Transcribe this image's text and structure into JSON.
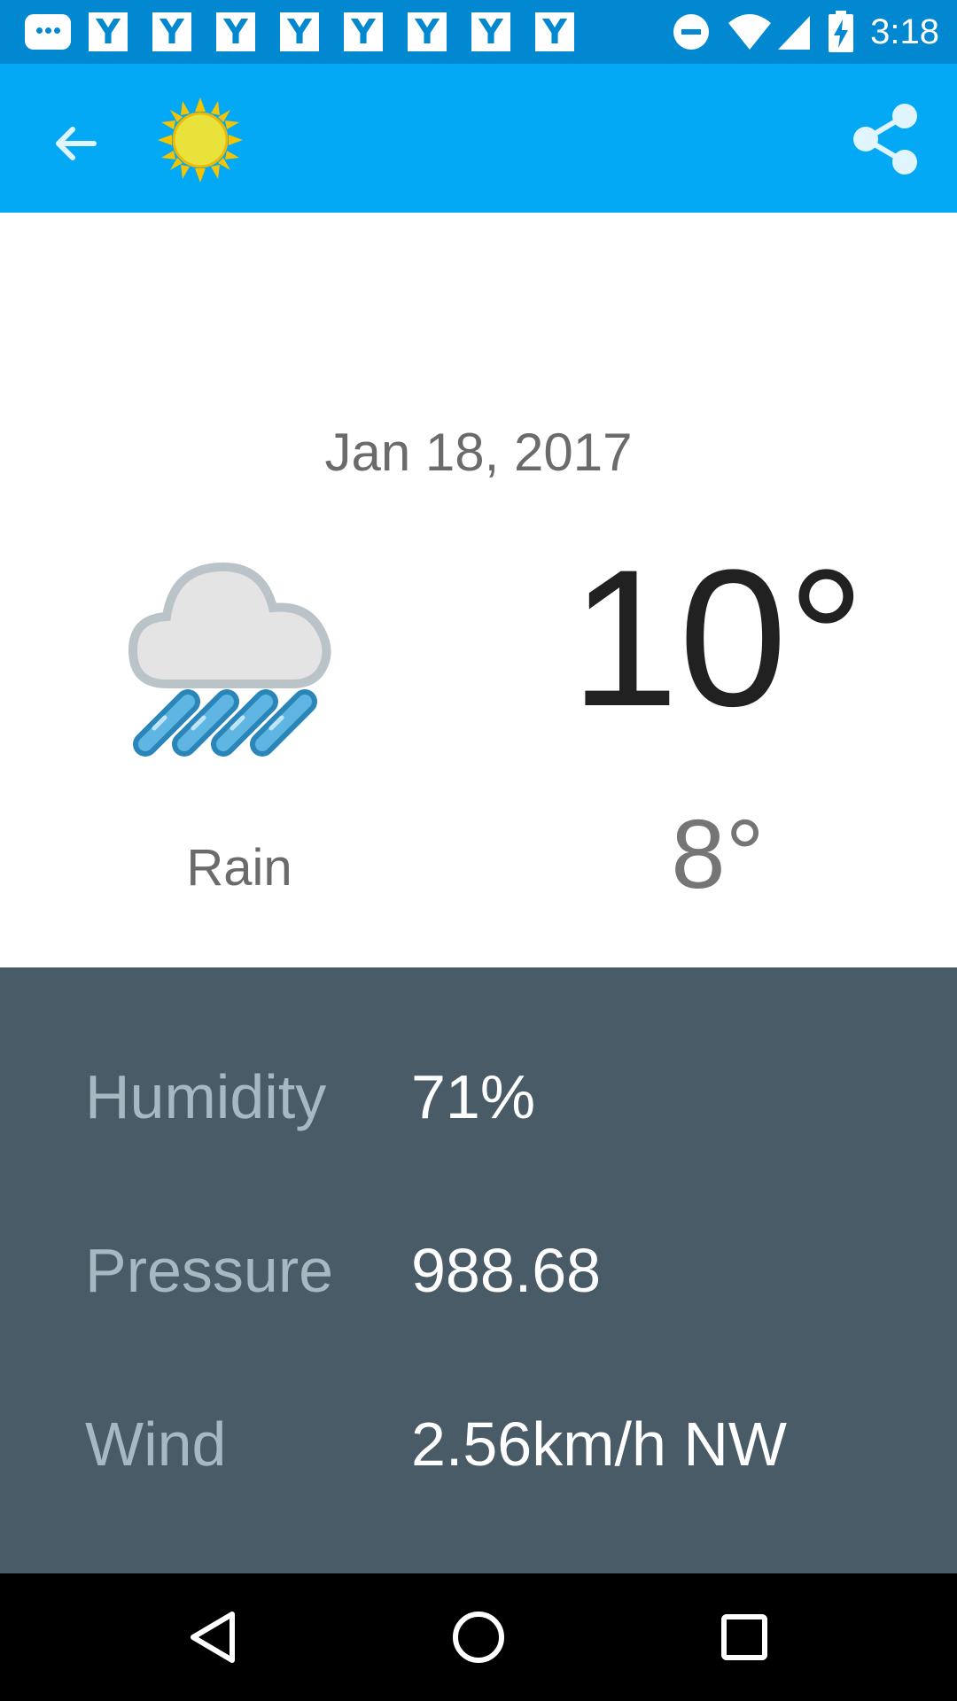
{
  "status_bar": {
    "time": "3:18",
    "notification_letter": "Y",
    "notification_count": 8,
    "icons": [
      "chat-notification-icon",
      "y-notification-icon",
      "do-not-disturb-icon",
      "wifi-icon",
      "cell-signal-icon",
      "battery-charging-icon"
    ]
  },
  "app_bar": {
    "back_icon": "arrow-back-icon",
    "logo_icon": "sun-logo-icon",
    "share_icon": "share-icon",
    "color": "#03a9f4"
  },
  "forecast": {
    "date": "Jan 18, 2017",
    "condition": "Rain",
    "condition_icon": "rain-cloud-icon",
    "high": "10°",
    "low": "8°"
  },
  "details": {
    "humidity": {
      "label": "Humidity",
      "value": "71%"
    },
    "pressure": {
      "label": "Pressure",
      "value": "988.68"
    },
    "wind": {
      "label": "Wind",
      "value": "2.56km/h NW"
    }
  },
  "nav_bar": {
    "icons": [
      "nav-back-icon",
      "nav-home-icon",
      "nav-recents-icon"
    ]
  },
  "colors": {
    "status_bar": "#0288d1",
    "app_bar": "#03a9f4",
    "details_bg": "#485b66",
    "details_label": "#a6b8c2"
  }
}
